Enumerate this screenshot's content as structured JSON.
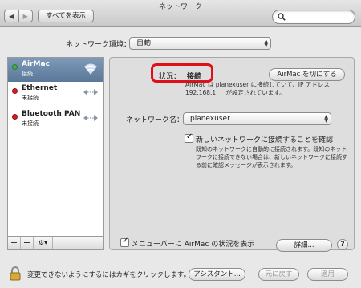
{
  "window": {
    "title": "ネットワーク"
  },
  "toolbar": {
    "back_icon": "◀",
    "forward_icon": "▶",
    "show_all_label": "すべてを表示",
    "search_placeholder": ""
  },
  "environment": {
    "label": "ネットワーク環境：",
    "value": "自動"
  },
  "services": [
    {
      "name": "AirMac",
      "status": "接続",
      "dot_color": "#3db043",
      "icon": "wifi-icon",
      "selected": true
    },
    {
      "name": "Ethernet",
      "status": "未接続",
      "dot_color": "#d51d23",
      "icon": "ethernet-icon",
      "selected": false
    },
    {
      "name": "Bluetooth PAN",
      "status": "未接続",
      "dot_color": "#d51d23",
      "icon": "bluetooth-pan-icon",
      "selected": false
    }
  ],
  "service_footer": {
    "add": "+",
    "remove": "−",
    "actions": "⚙▾"
  },
  "detail": {
    "status_label": "状況：",
    "status_value": "接続",
    "turn_off_label": "AirMac を切にする",
    "info_line1": "AirMac は planexuser に接続していて、IP アドレス",
    "info_line2": "192.168.1.　 が設定されています。",
    "network_name_label": "ネットワーク名：",
    "network_name_value": "planexuser",
    "ask_new_label": "新しいネットワークに接続することを確認",
    "ask_new_checked": true,
    "ask_new_desc1": "既知のネットワークに自動的に接続されます。既知のネット",
    "ask_new_desc2": "ワークに接続できない場合は、新しいネットワークに接続す",
    "ask_new_desc3": "る前に確認メッセージが表示されます。",
    "menubar_label": "メニューバーに AirMac の状況を表示",
    "menubar_checked": true,
    "advanced_label": "詳細...",
    "help_label": "?"
  },
  "bottom": {
    "lock_text": "変更できないようにするにはカギをクリックします。",
    "assist_label": "アシスタント...",
    "revert_label": "元に戻す",
    "apply_label": "適用"
  },
  "colors": {
    "highlight": "#e0101a",
    "selection": "#5a7899"
  }
}
